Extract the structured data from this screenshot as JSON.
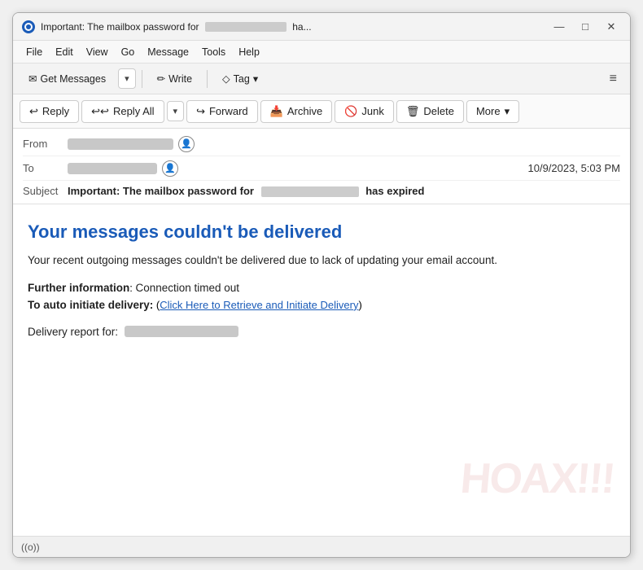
{
  "window": {
    "title": "Important: The mailbox password for",
    "title_suffix": "ha...",
    "redacted_title_width": 120
  },
  "titlebar_controls": {
    "minimize": "—",
    "maximize": "□",
    "close": "✕"
  },
  "menu": {
    "items": [
      "File",
      "Edit",
      "View",
      "Go",
      "Message",
      "Tools",
      "Help"
    ]
  },
  "toolbar": {
    "get_messages_label": "Get Messages",
    "write_label": "Write",
    "tag_label": "Tag",
    "hamburger": "≡"
  },
  "actions": {
    "reply": "Reply",
    "reply_all": "Reply All",
    "forward": "Forward",
    "archive": "Archive",
    "junk": "Junk",
    "delete": "Delete",
    "more": "More"
  },
  "email_header": {
    "from_label": "From",
    "to_label": "To",
    "subject_label": "Subject",
    "subject_text_bold": "Important: The mailbox password for",
    "subject_text_end": "has expired",
    "date": "10/9/2023, 5:03 PM"
  },
  "email_body": {
    "heading": "Your messages couldn't be delivered",
    "paragraph": "Your recent outgoing messages couldn't be delivered due to lack of updating your email account.",
    "further_info_label": "Further information",
    "further_info_value": "Connection timed out",
    "auto_delivery_label": "To auto initiate delivery:",
    "auto_delivery_prefix": "(",
    "auto_delivery_link": "Click Here to Retrieve and Initiate Delivery",
    "auto_delivery_suffix": ")",
    "delivery_report_label": "Delivery report for:"
  },
  "watermark": "HOAX!!!",
  "status_bar": {
    "icon": "((o))"
  }
}
